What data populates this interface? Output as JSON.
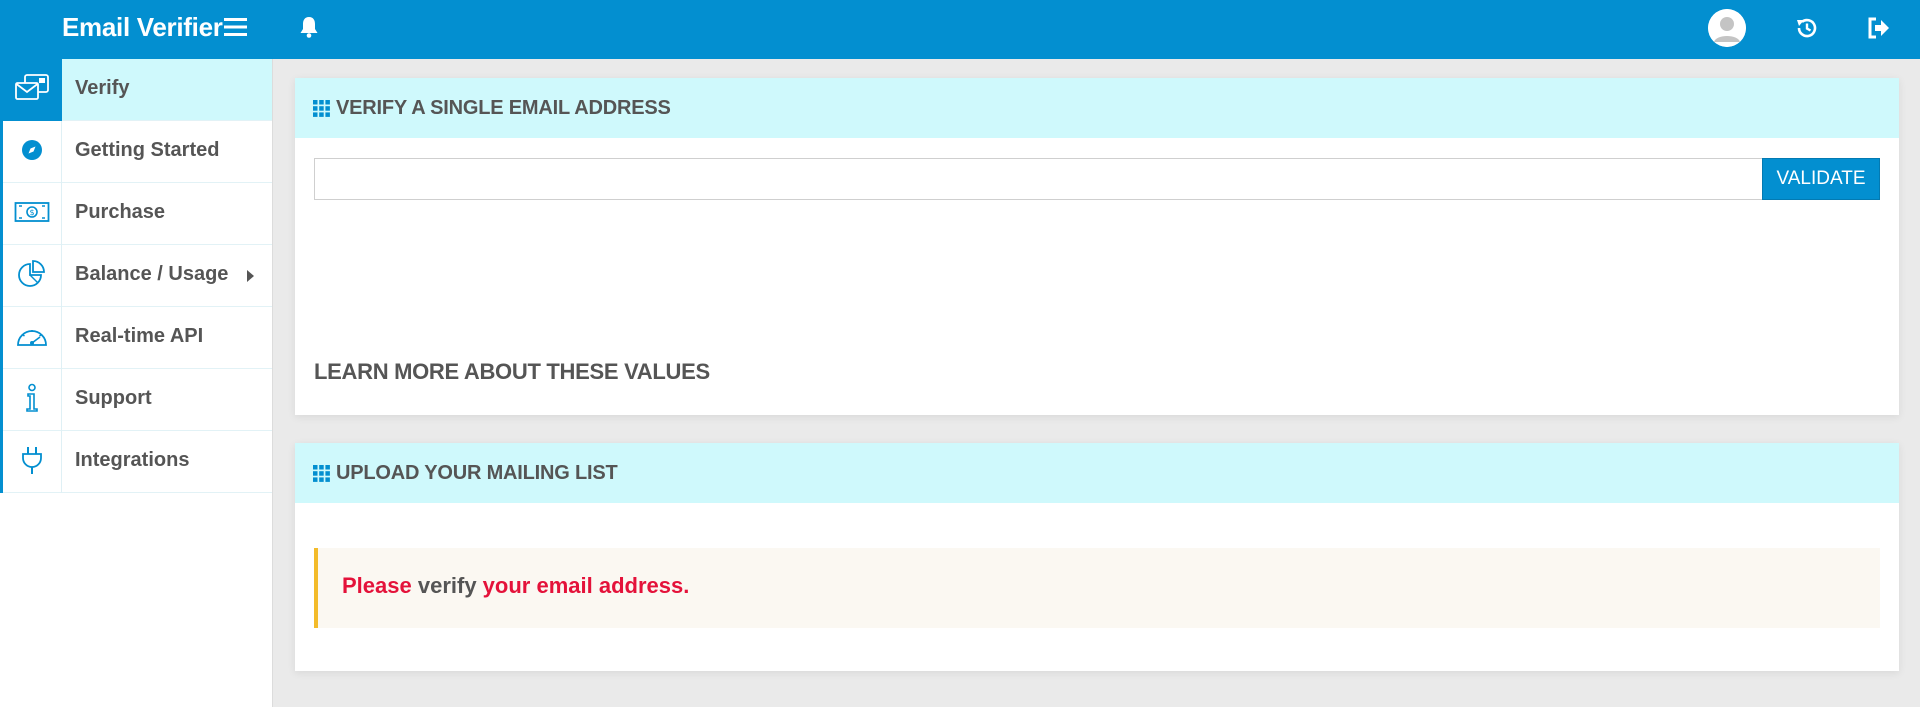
{
  "header": {
    "brand": "Email Verifier"
  },
  "sidebar": {
    "items": [
      {
        "label": "Verify",
        "icon": "email-card-icon",
        "active": true
      },
      {
        "label": "Getting Started",
        "icon": "compass-icon"
      },
      {
        "label": "Purchase",
        "icon": "banknote-icon"
      },
      {
        "label": "Balance / Usage",
        "icon": "pie-chart-icon",
        "has_submenu": true
      },
      {
        "label": "Real-time API",
        "icon": "speedometer-icon"
      },
      {
        "label": "Support",
        "icon": "info-icon"
      },
      {
        "label": "Integrations",
        "icon": "plug-icon"
      }
    ]
  },
  "verify_panel": {
    "title": "VERIFY A SINGLE EMAIL ADDRESS",
    "input_value": "",
    "validate_label": "VALIDATE",
    "learn_more": "LEARN MORE ABOUT THESE VALUES"
  },
  "upload_panel": {
    "title": "UPLOAD YOUR MAILING LIST",
    "alert_part1": "Please",
    "alert_part2": " verify ",
    "alert_part3": "your email address."
  },
  "colors": {
    "primary": "#038fd0",
    "panel_header_bg": "#cff9fc",
    "alert_border": "#f3bb2a",
    "alert_text_red": "#e4123a"
  }
}
